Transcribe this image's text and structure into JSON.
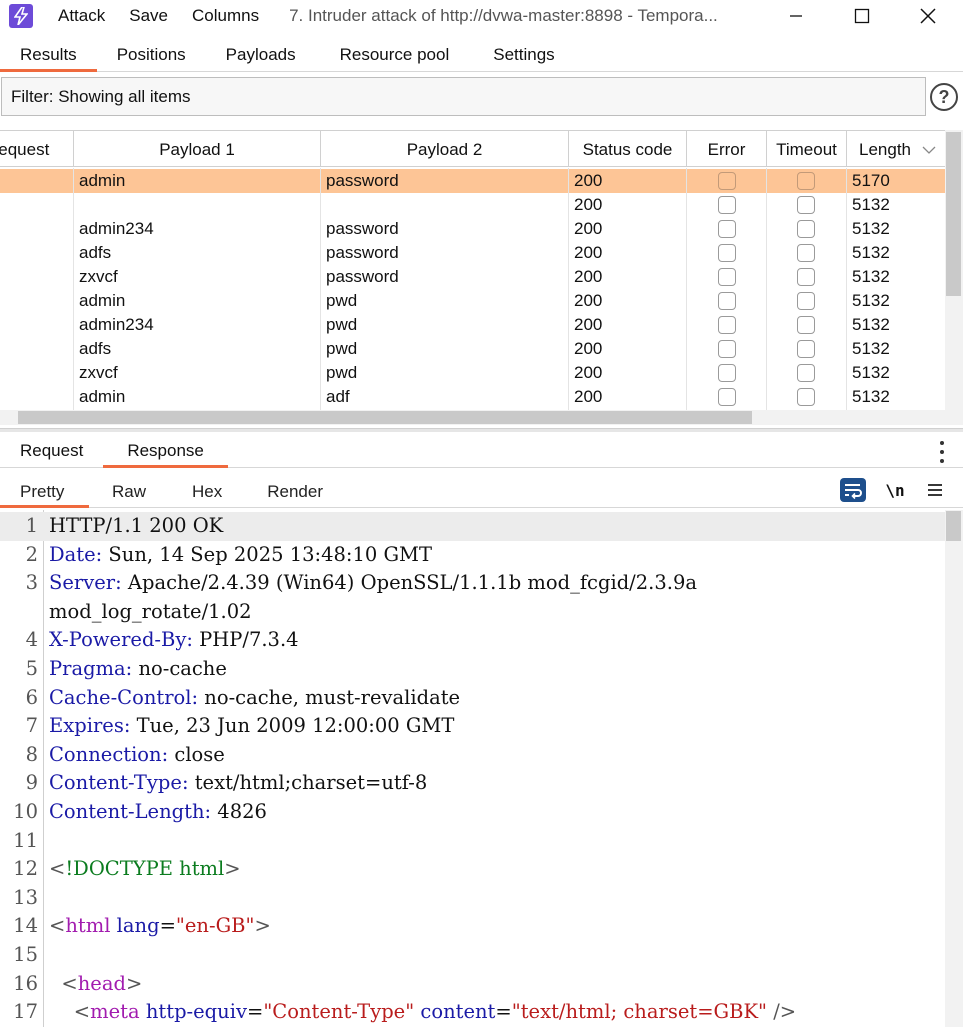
{
  "window": {
    "menu": [
      "Attack",
      "Save",
      "Columns"
    ],
    "title": "7. Intruder attack of http://dvwa-master:8898 - Tempora..."
  },
  "tabs": [
    "Results",
    "Positions",
    "Payloads",
    "Resource pool",
    "Settings"
  ],
  "filter": {
    "text": "Filter: Showing all items",
    "help": "?"
  },
  "table": {
    "columns": [
      "Request",
      "Payload 1",
      "Payload 2",
      "Status code",
      "Error",
      "Timeout",
      "Length"
    ],
    "rows": [
      {
        "payload1": "admin",
        "payload2": "password",
        "status": "200",
        "length": "5170",
        "selected": true
      },
      {
        "payload1": "",
        "payload2": "",
        "status": "200",
        "length": "5132"
      },
      {
        "payload1": "admin234",
        "payload2": "password",
        "status": "200",
        "length": "5132"
      },
      {
        "payload1": "adfs",
        "payload2": "password",
        "status": "200",
        "length": "5132"
      },
      {
        "payload1": "zxvcf",
        "payload2": "password",
        "status": "200",
        "length": "5132"
      },
      {
        "payload1": "admin",
        "payload2": "pwd",
        "status": "200",
        "length": "5132"
      },
      {
        "payload1": "admin234",
        "payload2": "pwd",
        "status": "200",
        "length": "5132"
      },
      {
        "payload1": "adfs",
        "payload2": "pwd",
        "status": "200",
        "length": "5132"
      },
      {
        "payload1": "zxvcf",
        "payload2": "pwd",
        "status": "200",
        "length": "5132"
      },
      {
        "payload1": "admin",
        "payload2": "adf",
        "status": "200",
        "length": "5132"
      }
    ]
  },
  "message_tabs": [
    "Request",
    "Response"
  ],
  "view_tabs": [
    "Pretty",
    "Raw",
    "Hex",
    "Render"
  ],
  "view_icons": {
    "newline_label": "\\n"
  },
  "editor": {
    "lines": [
      {
        "n": "1",
        "parts": [
          [
            "val",
            "HTTP/1.1 200 OK"
          ]
        ]
      },
      {
        "n": "2",
        "parts": [
          [
            "key",
            "Date"
          ],
          [
            "punct",
            ":"
          ],
          [
            "val",
            " Sun, 14 Sep 2025 13:48:10 GMT"
          ]
        ]
      },
      {
        "n": "3",
        "parts": [
          [
            "key",
            "Server"
          ],
          [
            "punct",
            ":"
          ],
          [
            "val",
            " Apache/2.4.39 (Win64) OpenSSL/1.1.1b mod_fcgid/2.3.9a"
          ]
        ]
      },
      {
        "n": "",
        "parts": [
          [
            "val",
            "mod_log_rotate/1.02"
          ]
        ]
      },
      {
        "n": "4",
        "parts": [
          [
            "key",
            "X-Powered-By"
          ],
          [
            "punct",
            ":"
          ],
          [
            "val",
            " PHP/7.3.4"
          ]
        ]
      },
      {
        "n": "5",
        "parts": [
          [
            "key",
            "Pragma"
          ],
          [
            "punct",
            ":"
          ],
          [
            "val",
            " no-cache"
          ]
        ]
      },
      {
        "n": "6",
        "parts": [
          [
            "key",
            "Cache-Control"
          ],
          [
            "punct",
            ":"
          ],
          [
            "val",
            " no-cache, must-revalidate"
          ]
        ]
      },
      {
        "n": "7",
        "parts": [
          [
            "key",
            "Expires"
          ],
          [
            "punct",
            ":"
          ],
          [
            "val",
            " Tue, 23 Jun 2009 12:00:00 GMT"
          ]
        ]
      },
      {
        "n": "8",
        "parts": [
          [
            "key",
            "Connection"
          ],
          [
            "punct",
            ":"
          ],
          [
            "val",
            " close"
          ]
        ]
      },
      {
        "n": "9",
        "parts": [
          [
            "key",
            "Content-Type"
          ],
          [
            "punct",
            ":"
          ],
          [
            "val",
            " text/html;charset=utf-8"
          ]
        ]
      },
      {
        "n": "10",
        "parts": [
          [
            "key",
            "Content-Length"
          ],
          [
            "punct",
            ":"
          ],
          [
            "val",
            " 4826"
          ]
        ]
      },
      {
        "n": "11",
        "parts": []
      },
      {
        "n": "12",
        "parts": [
          [
            "bracket",
            "<"
          ],
          [
            "doctype",
            "!DOCTYPE html"
          ],
          [
            "bracket",
            ">"
          ]
        ]
      },
      {
        "n": "13",
        "parts": []
      },
      {
        "n": "14",
        "parts": [
          [
            "bracket",
            "<"
          ],
          [
            "tag",
            "html"
          ],
          [
            "val",
            " "
          ],
          [
            "attr",
            "lang"
          ],
          [
            "val",
            "="
          ],
          [
            "str",
            "\"en-GB\""
          ],
          [
            "bracket",
            ">"
          ]
        ]
      },
      {
        "n": "15",
        "parts": []
      },
      {
        "n": "16",
        "parts": [
          [
            "val",
            "  "
          ],
          [
            "bracket",
            "<"
          ],
          [
            "tag",
            "head"
          ],
          [
            "bracket",
            ">"
          ]
        ]
      },
      {
        "n": "17",
        "parts": [
          [
            "val",
            "    "
          ],
          [
            "bracket",
            "<"
          ],
          [
            "tag",
            "meta"
          ],
          [
            "val",
            " "
          ],
          [
            "attr",
            "http-equiv"
          ],
          [
            "val",
            "="
          ],
          [
            "str",
            "\"Content-Type\""
          ],
          [
            "val",
            " "
          ],
          [
            "attr",
            "content"
          ],
          [
            "val",
            "="
          ],
          [
            "str",
            "\"text/html; charset=GBK\""
          ],
          [
            "val",
            " "
          ],
          [
            "bracket",
            "/>"
          ]
        ]
      }
    ]
  },
  "colors": {
    "accent": "#ef6a3e",
    "selected_row": "#fdc596",
    "app_icon": "#6d4bd8"
  }
}
